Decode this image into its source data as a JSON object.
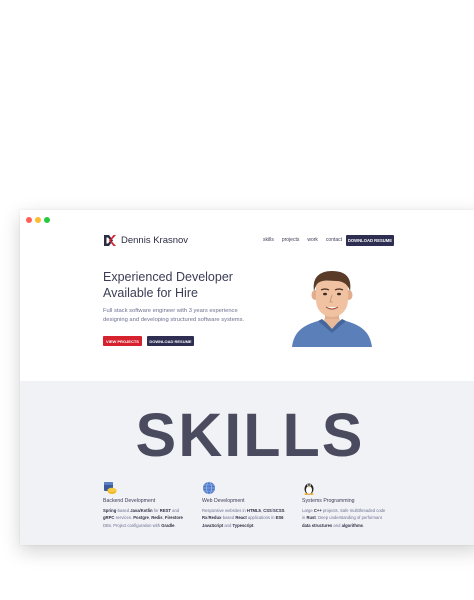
{
  "brand": {
    "name": "Dennis Krasnov"
  },
  "nav": {
    "links": [
      "skills",
      "projects",
      "work",
      "contact"
    ],
    "resume_button": "DOWNLOAD RESUME"
  },
  "hero": {
    "title_line1": "Experienced Developer",
    "title_line2": "Available for Hire",
    "sub_line1": "Full stack software engineer with 3 years experience",
    "sub_line2": "designing and developing structured software systems.",
    "view_projects": "VIEW PROJECTS",
    "download_resume": "DOWNLOAD RESUME"
  },
  "skills": {
    "title": "SKILLS",
    "columns": [
      {
        "icon": "database-icon",
        "title": "Backend Development",
        "lines": [
          "<b>Spring</b>-based <b>Java/Kotlin</b> for <b>REST</b> and",
          "<b>gRPC</b> services. <b>Postgre</b>, <b>Redis</b>, <b>Firestore</b>",
          "DBs. Project configuration with <b>Gradle</b>."
        ]
      },
      {
        "icon": "globe-icon",
        "title": "Web Development",
        "lines": [
          "Responsive websites in <b>HTML5</b>, <b>CSS</b>/<b>SCSS</b>.",
          "<b>Rx</b>/<b>Redux</b>-based <b>React</b> applications in <b>ES6</b>",
          "<b>JavaScript</b> and <b>Typescript</b>."
        ]
      },
      {
        "icon": "linux-penguin-icon",
        "title": "Systems Programming",
        "lines": [
          "Large <b>C++</b> projects. Safe multithreaded code",
          "in <b>Rust</b>. Deep understanding of performant",
          "<b>data structures</b> and <b>algorithms</b>."
        ]
      }
    ]
  },
  "colors": {
    "accent_red": "#d6212e",
    "navy": "#2d2e52",
    "skills_bg": "#f1f2f6"
  }
}
